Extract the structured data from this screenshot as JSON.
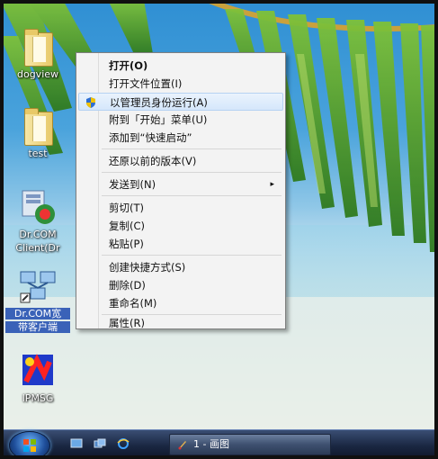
{
  "desktop": {
    "icons": [
      {
        "label": "dogview",
        "icon": "folder-icon"
      },
      {
        "label": "test",
        "icon": "folder-icon"
      },
      {
        "label": "Dr.COM",
        "sublabel": "Client(Dr",
        "icon": "drcom-client-icon"
      },
      {
        "label": "Dr.COM宽",
        "sublabel": "带客户端",
        "icon": "network-computers-icon"
      },
      {
        "label": "IPMSG",
        "icon": "ipmsg-icon"
      }
    ]
  },
  "context_menu": {
    "items": [
      {
        "label": "打开(O)",
        "bold": true
      },
      {
        "label": "打开文件位置(I)"
      },
      {
        "label": "以管理员身份运行(A)",
        "icon": "uac-shield-icon",
        "highlighted": true
      },
      {
        "label": "附到「开始」菜单(U)"
      },
      {
        "label": "添加到“快速启动”"
      },
      {
        "label": "还原以前的版本(V)"
      },
      {
        "label": "发送到(N)",
        "submenu": "▸"
      },
      {
        "label": "剪切(T)"
      },
      {
        "label": "复制(C)"
      },
      {
        "label": "粘贴(P)"
      },
      {
        "label": "创建快捷方式(S)"
      },
      {
        "label": "删除(D)"
      },
      {
        "label": "重命名(M)"
      },
      {
        "label": "属性(R)"
      }
    ]
  },
  "taskbar": {
    "start_icon": "windows-orb-icon",
    "quicklaunch": [
      "show-desktop-icon",
      "switch-windows-icon",
      "internet-explorer-icon"
    ],
    "task_button_label": "1 - 画图",
    "task_button_icon": "paint-icon"
  },
  "colors": {
    "menu_bg": "#f3f3f3",
    "menu_highlight": "#d5e7fb",
    "taskbar": "#1a2742"
  }
}
